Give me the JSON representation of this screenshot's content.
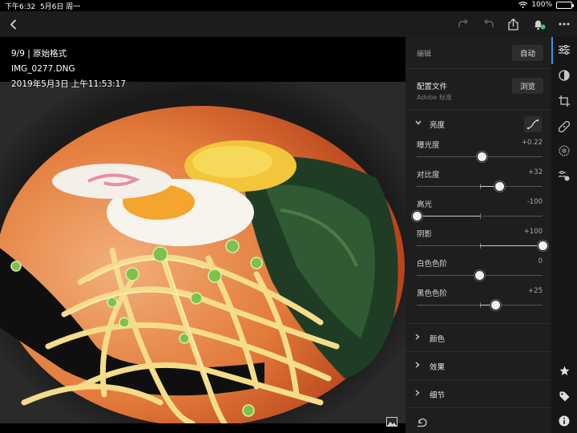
{
  "status_bar": {
    "time": "下午6:32",
    "date": "5月6日 周一",
    "battery": "100%"
  },
  "photo_overlay": {
    "counter": "9/9 | 原始格式",
    "filename": "IMG_0277.DNG",
    "datetime": "2019年5月3日 上午11:53:17"
  },
  "panel": {
    "edit_label": "编辑",
    "auto_button": "自动",
    "profile_title": "配置文件",
    "profile_value": "Adobe 标准",
    "browse_button": "浏览",
    "light_section": "亮度",
    "sliders": [
      {
        "label": "曝光度",
        "value": "+0.22",
        "level": 0.522,
        "min": -5,
        "max": 5
      },
      {
        "label": "对比度",
        "value": "+32",
        "level": 0.66,
        "min": -100,
        "max": 100
      },
      {
        "label": "高光",
        "value": "-100",
        "level": 0.0,
        "min": -100,
        "max": 100
      },
      {
        "label": "阴影",
        "value": "+100",
        "level": 1.0,
        "min": -100,
        "max": 100
      },
      {
        "label": "白色色阶",
        "value": "0",
        "level": 0.5,
        "min": -100,
        "max": 100
      },
      {
        "label": "黑色色阶",
        "value": "+25",
        "level": 0.625,
        "min": -100,
        "max": 100
      }
    ],
    "collapsed_sections": [
      "颜色",
      "效果",
      "细节"
    ]
  },
  "colors": {
    "accent": "#3d8ef0",
    "panel_bg": "#1e1e1e",
    "rail_bg": "#161616",
    "toolbar_bg": "#1c1c1c"
  },
  "icons": {
    "toolbar": [
      "back-chevron-icon",
      "redo-icon",
      "undo-icon",
      "share-icon",
      "notification-bell-icon",
      "more-icon"
    ],
    "rail": [
      "adjust-sliders-icon",
      "presets-icon",
      "crop-icon",
      "healing-icon",
      "mask-radial-icon",
      "selective-icon",
      "star-rating-icon",
      "tag-icon",
      "info-icon"
    ],
    "panel": [
      "curve-icon",
      "reset-icon"
    ],
    "photo": [
      "compare-icon"
    ]
  }
}
